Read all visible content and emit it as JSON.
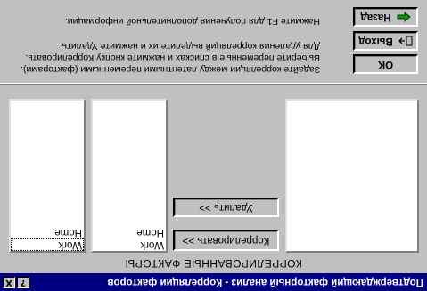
{
  "window": {
    "title": "Подтверждающий факторный анализ - Корреляции факторов",
    "help_btn": "?",
    "close_btn": "X"
  },
  "caption": "КОРРЕЛИРОВАННЫЕ ФАКТОРЫ",
  "lists": {
    "left": {
      "items": [
        "Work",
        "Home"
      ],
      "focused": 0
    },
    "middle": {
      "items": [
        "Work",
        "Home"
      ]
    },
    "right": {
      "items": []
    }
  },
  "buttons": {
    "correlate": "Коррелировать >>",
    "delete": "Удалить >>",
    "ok": "OK",
    "exit": "Выход",
    "back": "Назад"
  },
  "info": {
    "line1": "Задайте корреляции между латентными переменными (факторами).",
    "line2": "Выберите переменные в списках и нажмите кнопку Коррелировать.",
    "line3": "Для удаления корреляций выделите их и нажмите Удалить.",
    "line4": "Нажмите F1 для получения дополнительной информации."
  },
  "icons": {
    "exit_icon": "door-exit-icon",
    "back_icon": "green-left-arrow-icon"
  }
}
